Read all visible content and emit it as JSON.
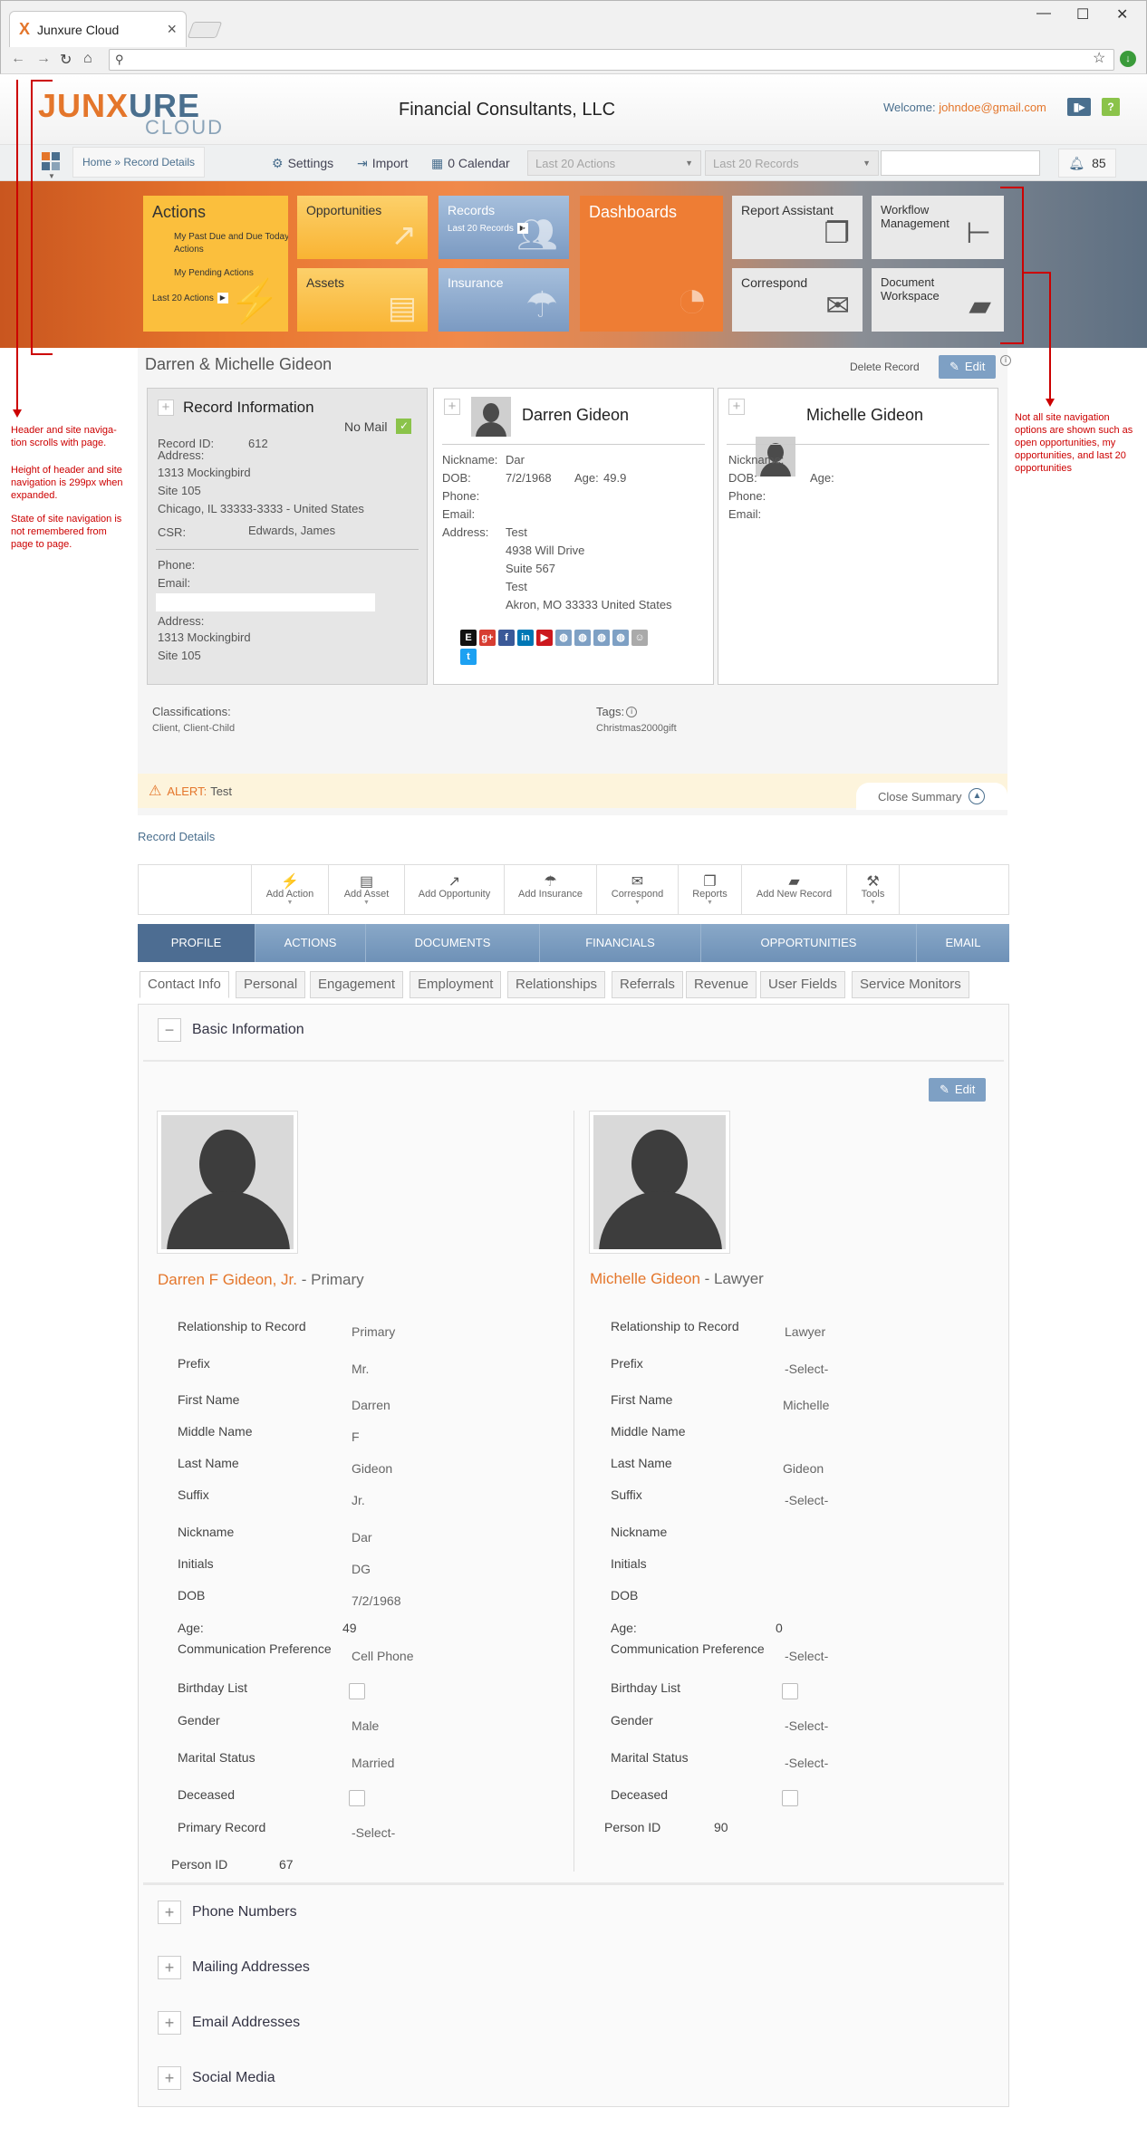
{
  "browser": {
    "tab_title": "Junxure Cloud",
    "tab_logo": "X",
    "address": ""
  },
  "header": {
    "logo_part1": "JUNX",
    "logo_part2": "URE",
    "logo_sub": "CLOUD",
    "firm": "Financial Consultants, LLC",
    "welcome": "Welcome:",
    "email": "johndoe@gmail.com"
  },
  "toolbar": {
    "breadcrumb": "Home » Record Details",
    "settings": "Settings",
    "import": "Import",
    "calendar": "0 Calendar",
    "dd1": "Last 20 Actions",
    "dd2": "Last 20 Records",
    "notifications": "85"
  },
  "nav": {
    "actions": "Actions",
    "past_due": "My Past Due and Due Today Actions",
    "pending": "My Pending Actions",
    "last20_actions": "Last 20 Actions",
    "opportunities": "Opportunities",
    "assets": "Assets",
    "records": "Records",
    "last20_records": "Last 20 Records",
    "insurance": "Insurance",
    "dashboards": "Dashboards",
    "report_assistant": "Report Assistant",
    "correspond": "Correspond",
    "workflow": "Workflow Management",
    "doc_workspace": "Document Workspace"
  },
  "annotations": {
    "left1": "Header and site naviga-tion scrolls with page.",
    "left2": "Height of header and site navigation is 299px when expanded.",
    "left3": "State of site navigation is not remembered from page to page.",
    "right1": "Not all site navigation options are shown such as open opportunities, my opportunities, and last 20 opportunities"
  },
  "summary": {
    "title": "Darren & Michelle Gideon",
    "delete": "Delete Record",
    "edit": "Edit",
    "record_info": "Record Information",
    "no_mail": "No Mail",
    "record_id_label": "Record ID:",
    "record_id": "612",
    "address_label": "Address:",
    "addr1": "1313 Mockingbird",
    "addr2": "Site 105",
    "addr3": "Chicago, IL 33333-3333 - United States",
    "csr_label": "CSR:",
    "csr": "Edwards, James",
    "phone_label": "Phone:",
    "email_label": "Email:",
    "address2_label": "Address:",
    "addr2_1": "1313 Mockingbird",
    "addr2_2": "Site 105",
    "p1_name": "Darren Gideon",
    "p1_nick_label": "Nickname:",
    "p1_nick": "Dar",
    "p1_dob_label": "DOB:",
    "p1_dob": "7/2/1968",
    "p1_age_label": "Age:",
    "p1_age": "49.9",
    "p1_phone_label": "Phone:",
    "p1_email_label": "Email:",
    "p1_addr_label": "Address:",
    "p1_addr1": "Test",
    "p1_addr2": "4938 Will Drive",
    "p1_addr3": "Suite 567",
    "p1_addr4": "Test",
    "p1_addr5": "Akron, MO 33333 United States",
    "p2_name": "Michelle Gideon",
    "p2_nick_label": "Nickname:",
    "p2_dob_label": "DOB:",
    "p2_age_label": "Age:",
    "p2_phone_label": "Phone:",
    "p2_email_label": "Email:",
    "classifications_label": "Classifications:",
    "classifications": "Client, Client-Child",
    "tags_label": "Tags:",
    "tags": "Christmas2000gift",
    "alert_label": "ALERT:",
    "alert_text": "Test",
    "close_summary": "Close Summary"
  },
  "record_details": {
    "title": "Record Details",
    "actions": [
      "Add Action",
      "Add Asset",
      "Add Opportunity",
      "Add Insurance",
      "Correspond",
      "Reports",
      "Add New Record",
      "Tools"
    ],
    "main_tabs": [
      "PROFILE",
      "ACTIONS",
      "DOCUMENTS",
      "FINANCIALS",
      "OPPORTUNITIES",
      "EMAIL"
    ],
    "sub_tabs": [
      "Contact Info",
      "Personal",
      "Engagement",
      "Employment",
      "Relationships",
      "Referrals",
      "Revenue",
      "User Fields",
      "Service Monitors"
    ]
  },
  "basic": {
    "title": "Basic Information",
    "edit": "Edit",
    "p1_fullname": "Darren F Gideon, Jr.",
    "p1_role": " - Primary",
    "p2_fullname": "Michelle Gideon",
    "p2_role": " - Lawyer",
    "labels": {
      "rel": "Relationship to Record",
      "prefix": "Prefix",
      "first": "First Name",
      "middle": "Middle Name",
      "last": "Last Name",
      "suffix": "Suffix",
      "nick": "Nickname",
      "initials": "Initials",
      "dob": "DOB",
      "age": "Age:",
      "comm": "Communication Preference",
      "bday": "Birthday List",
      "gender": "Gender",
      "marital": "Marital Status",
      "deceased": "Deceased",
      "primary": "Primary Record",
      "person_id": "Person ID"
    },
    "p1": {
      "rel": "Primary",
      "prefix": "Mr.",
      "first": "Darren",
      "middle": "F",
      "last": "Gideon",
      "suffix": "Jr.",
      "nick": "Dar",
      "initials": "DG",
      "dob": "7/2/1968",
      "age": "49",
      "comm": "Cell Phone",
      "gender": "Male",
      "marital": "Married",
      "primary": "-Select-",
      "person_id": "67"
    },
    "p2": {
      "rel": "Lawyer",
      "prefix": "-Select-",
      "first": "Michelle",
      "last": "Gideon",
      "suffix": "-Select-",
      "age": "0",
      "comm": "-Select-",
      "gender": "-Select-",
      "marital": "-Select-",
      "person_id": "90"
    },
    "sections": [
      "Phone Numbers",
      "Mailing Addresses",
      "Email Addresses",
      "Social Media"
    ]
  }
}
